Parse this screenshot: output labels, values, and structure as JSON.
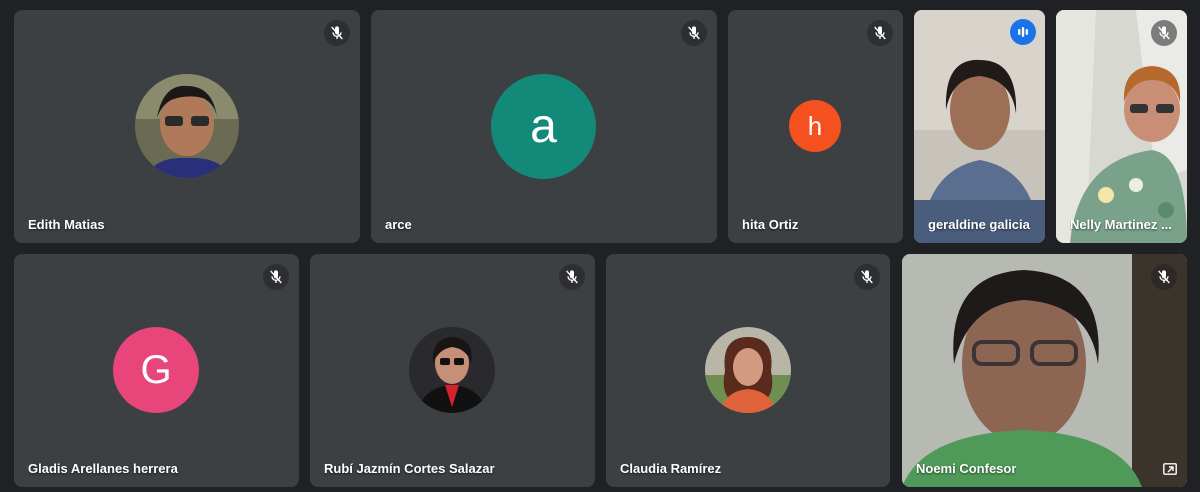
{
  "colors": {
    "background": "#202124",
    "tile": "#3c4043",
    "speaking_border": "#8ab4f8",
    "speaking_badge": "#1a73e8",
    "avatar_arce": "#13897a",
    "avatar_hita": "#f4511e",
    "avatar_gladis": "#e8457a"
  },
  "participants": [
    {
      "name": "Edith Matias",
      "avatar": "photo",
      "mic": "muted-icon"
    },
    {
      "name": "arce",
      "avatar_letter": "a",
      "mic": "muted-icon"
    },
    {
      "name": "hita Ortiz",
      "avatar_letter": "h",
      "mic": "muted-icon"
    },
    {
      "name": "geraldine galicia",
      "avatar": "video",
      "mic": "speaking-icon"
    },
    {
      "name": "Nelly Martinez ...",
      "avatar": "video",
      "mic": "muted-icon"
    },
    {
      "name": "Gladis Arellanes herrera",
      "avatar_letter": "G",
      "mic": "muted-icon"
    },
    {
      "name": "Rubí Jazmín Cortes Salazar",
      "avatar": "photo",
      "mic": "muted-icon"
    },
    {
      "name": "Claudia Ramírez",
      "avatar": "photo",
      "mic": "muted-icon"
    },
    {
      "name": "Noemi Confesor",
      "avatar": "video",
      "mic": "muted-icon"
    }
  ]
}
